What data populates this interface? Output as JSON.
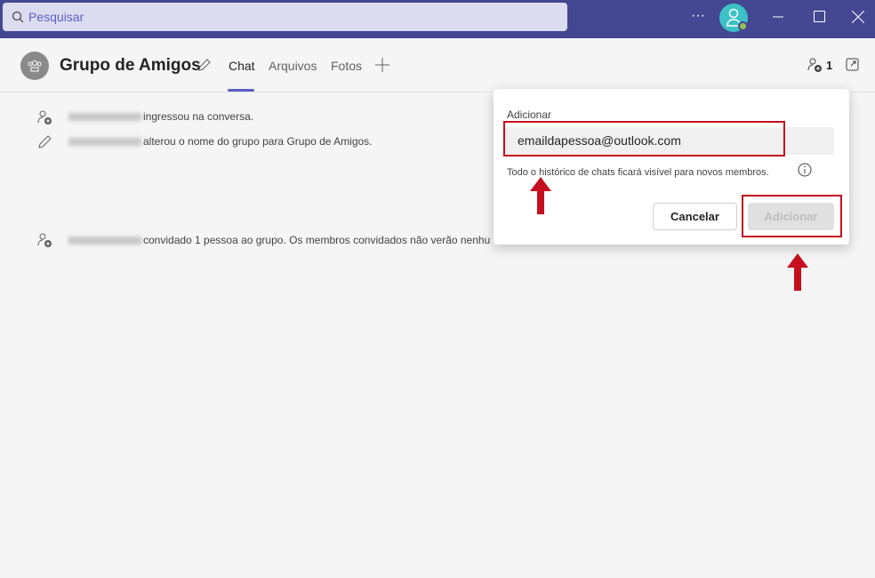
{
  "titlebar": {
    "search_placeholder": "Pesquisar",
    "more": "···"
  },
  "header": {
    "title": "Grupo de Amigos",
    "tabs": [
      {
        "label": "Chat",
        "active": true
      },
      {
        "label": "Arquivos"
      },
      {
        "label": "Fotos"
      }
    ],
    "participants_count": "1"
  },
  "messages": [
    {
      "icon": "person-add-icon",
      "text": "ingressou na conversa."
    },
    {
      "icon": "pencil-icon",
      "text": "alterou o nome do grupo para Grupo de Amigos."
    },
    {
      "icon": "person-add-icon",
      "text": "convidado 1 pessoa ao grupo. Os membros convidados não verão nenhu"
    }
  ],
  "popup": {
    "label": "Adicionar",
    "input_value": "emaildapessoa@outlook.com",
    "hint": "Todo o histórico de chats ficará visível para novos membros.",
    "cancel": "Cancelar",
    "add": "Adicionar"
  },
  "colors": {
    "titlebar": "#444791",
    "accent": "#5b5fc7",
    "annotation": "#c50f1f"
  }
}
